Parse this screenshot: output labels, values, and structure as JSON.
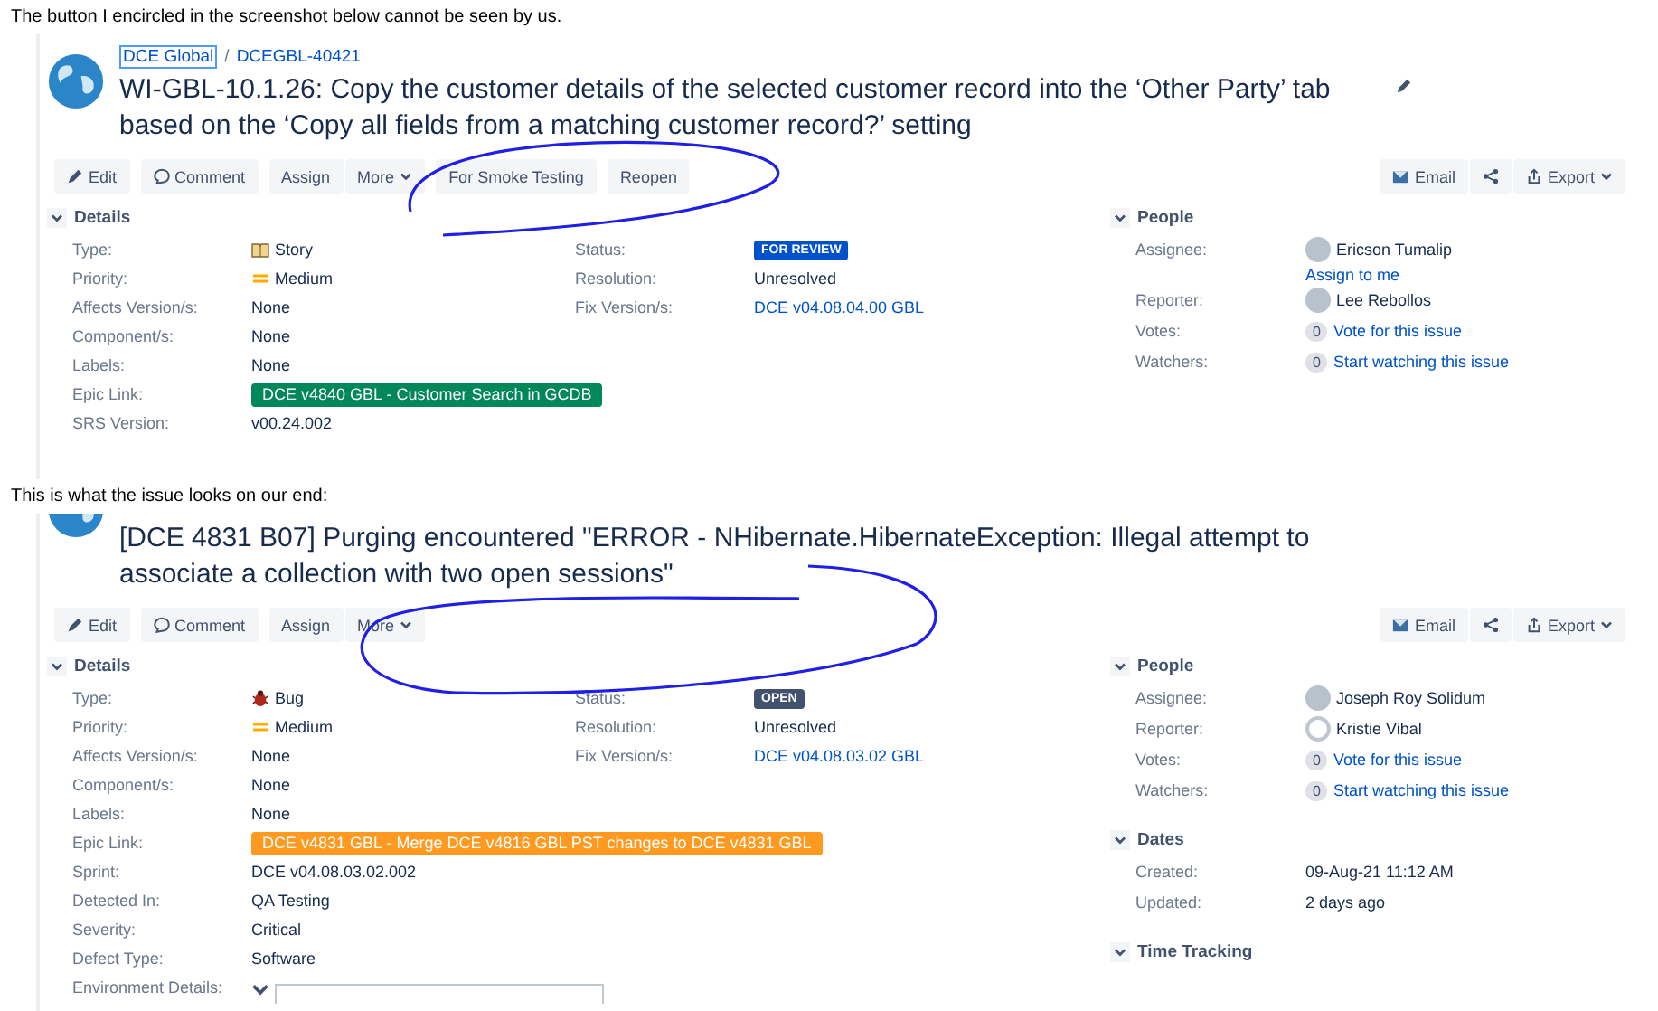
{
  "shots": [
    {
      "caption": "The button I encircled in the screenshot below cannot be seen by us.",
      "breadcrumb": {
        "project": "DCE Global",
        "separator": "/",
        "key": "DCEGBL-40421"
      },
      "title_lines": [
        "WI-GBL-10.1.26: Copy the customer details of the selected customer record into the ‘Other Party’ tab",
        "based on the ‘Copy all fields from a matching customer record?’ setting"
      ],
      "title_editable": true,
      "action_groups": [
        [
          {
            "label": "Edit",
            "kind": "edit"
          }
        ],
        [
          {
            "label": "Comment",
            "kind": "comment"
          }
        ],
        [
          {
            "label": "Assign",
            "kind": "plain"
          },
          {
            "label": "More",
            "kind": "menu"
          }
        ],
        [
          {
            "label": "For Smoke Testing",
            "kind": "plain"
          }
        ],
        [
          {
            "label": "Reopen",
            "kind": "plain"
          }
        ]
      ],
      "tools": [
        {
          "label": "Email",
          "kind": "email"
        },
        {
          "kind": "share"
        },
        {
          "label": "Export",
          "kind": "export"
        }
      ],
      "details": {
        "heading": "Details",
        "expanded": true,
        "columns": [
          [
            {
              "label": "Type:",
              "kind": "story",
              "value": "Story"
            },
            {
              "label": "Priority:",
              "kind": "priority",
              "value": "Medium"
            },
            {
              "label": "Affects Version/s:",
              "kind": "text",
              "value": "None"
            },
            {
              "label": "Component/s:",
              "kind": "text",
              "value": "None"
            },
            {
              "label": "Labels:",
              "kind": "text",
              "value": "None"
            },
            {
              "label": "Epic Link:",
              "kind": "epic",
              "value": "DCE v4840 GBL - Customer Search in GCDB",
              "color": "#00875a"
            },
            {
              "label": "SRS Version:",
              "kind": "text",
              "value": "v00.24.002"
            }
          ],
          [
            {
              "label": "Status:",
              "kind": "lozenge",
              "value": "FOR REVIEW",
              "color": "#0052cc"
            },
            {
              "label": "Resolution:",
              "kind": "text",
              "value": "Unresolved"
            },
            {
              "label": "Fix Version/s:",
              "kind": "link",
              "value": "DCE v04.08.04.00 GBL"
            }
          ]
        ]
      },
      "side_sections": [
        {
          "heading": "People",
          "expanded": true,
          "rows": [
            {
              "label": "Assignee:",
              "kind": "user",
              "value": "Ericson Tumalip",
              "link": "Assign to me"
            },
            {
              "label": "Reporter:",
              "kind": "user",
              "value": "Lee Rebollos"
            },
            {
              "label": "Votes:",
              "kind": "count",
              "count": "0",
              "value": "Vote for this issue"
            },
            {
              "label": "Watchers:",
              "kind": "count",
              "count": "0",
              "value": "Start watching this issue"
            }
          ]
        }
      ]
    },
    {
      "caption": "This is what the issue looks on our end:",
      "title_lines": [
        "[DCE 4831 B07] Purging encountered \"ERROR - NHibernate.HibernateException: Illegal attempt to",
        "associate a collection with two open sessions\""
      ],
      "title_editable": false,
      "action_groups": [
        [
          {
            "label": "Edit",
            "kind": "edit"
          }
        ],
        [
          {
            "label": "Comment",
            "kind": "comment"
          }
        ],
        [
          {
            "label": "Assign",
            "kind": "plain"
          },
          {
            "label": "More",
            "kind": "menu"
          }
        ]
      ],
      "tools": [
        {
          "label": "Email",
          "kind": "email"
        },
        {
          "kind": "share"
        },
        {
          "label": "Export",
          "kind": "export"
        }
      ],
      "details": {
        "heading": "Details",
        "expanded": true,
        "columns": [
          [
            {
              "label": "Type:",
              "kind": "bug",
              "value": "Bug"
            },
            {
              "label": "Priority:",
              "kind": "priority",
              "value": "Medium"
            },
            {
              "label": "Affects Version/s:",
              "kind": "text",
              "value": "None"
            },
            {
              "label": "Component/s:",
              "kind": "text",
              "value": "None"
            },
            {
              "label": "Labels:",
              "kind": "text",
              "value": "None"
            },
            {
              "label": "Epic Link:",
              "kind": "epic",
              "value": "DCE v4831 GBL - Merge DCE v4816 GBL PST changes to DCE v4831 GBL",
              "color": "#ff991f"
            },
            {
              "label": "Sprint:",
              "kind": "text",
              "value": "DCE v04.08.03.02.002"
            },
            {
              "label": "Detected In:",
              "kind": "text",
              "value": "QA Testing"
            },
            {
              "label": "Severity:",
              "kind": "text",
              "value": "Critical"
            },
            {
              "label": "Defect Type:",
              "kind": "text",
              "value": "Software"
            },
            {
              "label": "Environment Details:",
              "kind": "table"
            }
          ],
          [
            {
              "label": "Status:",
              "kind": "lozenge",
              "value": "OPEN",
              "color": "#42526e"
            },
            {
              "label": "Resolution:",
              "kind": "text",
              "value": "Unresolved"
            },
            {
              "label": "Fix Version/s:",
              "kind": "link",
              "value": "DCE v04.08.03.02 GBL"
            }
          ]
        ]
      },
      "side_sections": [
        {
          "heading": "People",
          "expanded": true,
          "rows": [
            {
              "label": "Assignee:",
              "kind": "user",
              "value": "Joseph Roy Solidum"
            },
            {
              "label": "Reporter:",
              "kind": "user-empty",
              "value": "Kristie Vibal"
            },
            {
              "label": "Votes:",
              "kind": "count",
              "count": "0",
              "value": "Vote for this issue"
            },
            {
              "label": "Watchers:",
              "kind": "count",
              "count": "0",
              "value": "Start watching this issue"
            }
          ]
        },
        {
          "heading": "Dates",
          "expanded": true,
          "rows": [
            {
              "label": "Created:",
              "kind": "text",
              "value": "09-Aug-21 11:12 AM"
            },
            {
              "label": "Updated:",
              "kind": "text",
              "value": "2 days ago"
            }
          ]
        },
        {
          "heading": "Time Tracking",
          "expanded": true
        }
      ]
    }
  ]
}
